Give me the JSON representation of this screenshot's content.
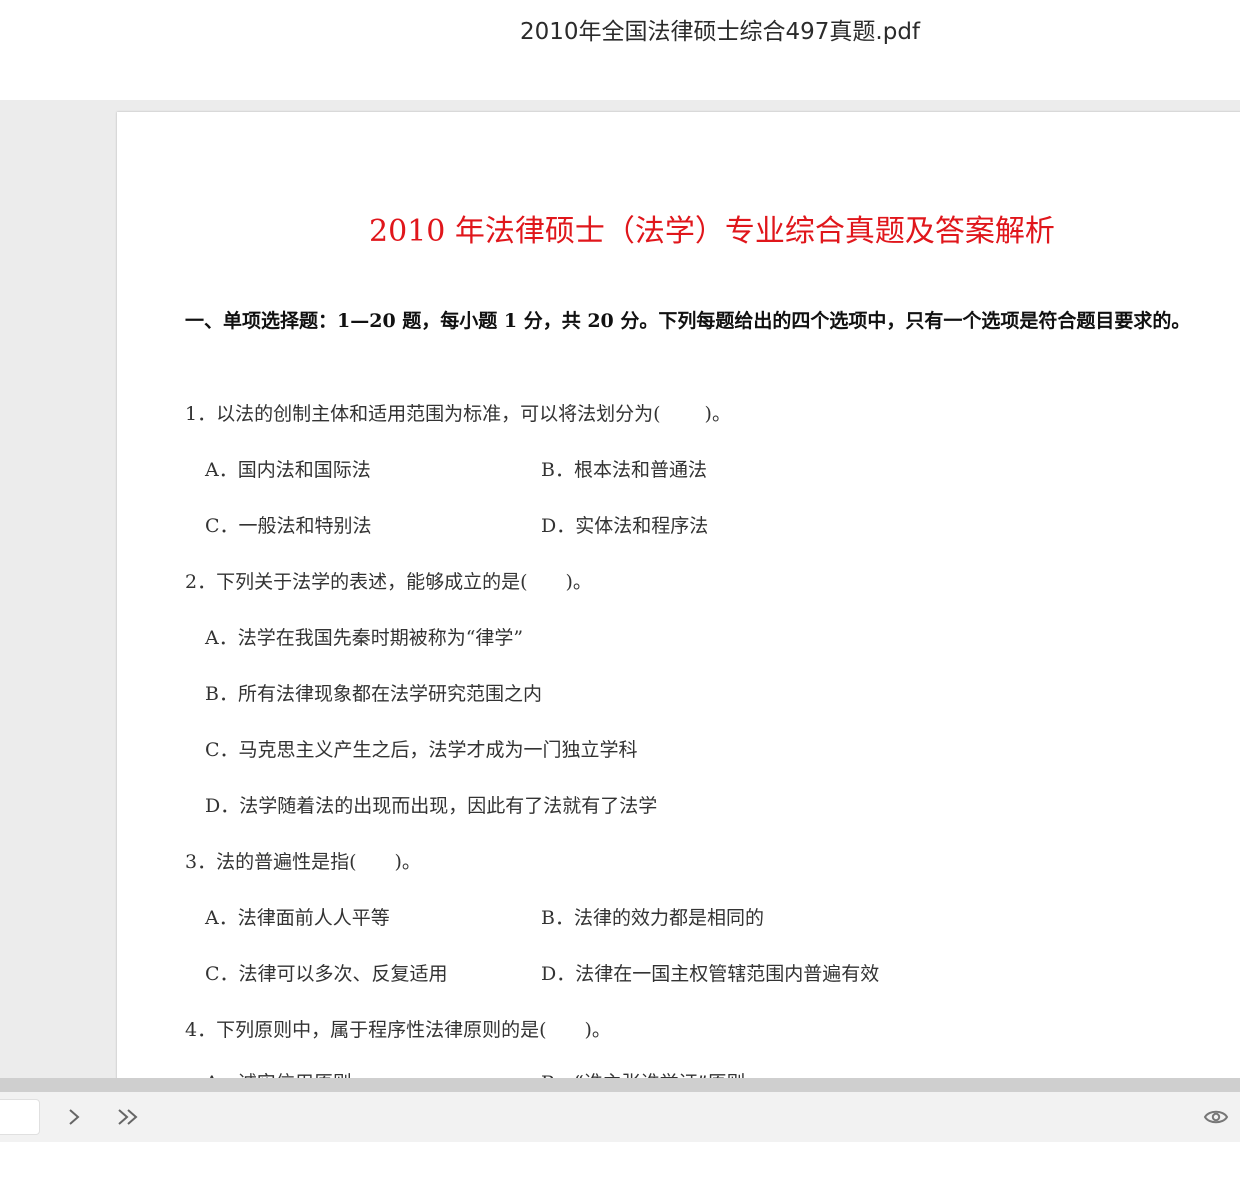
{
  "window": {
    "title": "2010年全国法律硕士综合497真题.pdf"
  },
  "document": {
    "heading": "2010 年法律硕士（法学）专业综合真题及答案解析",
    "section_intro": " 一、单项选择题：1—20 题，每小题 1 分，共 20 分。下列每题给出的四个选项中，只有一个选项是符合题目要求的。",
    "questions": [
      {
        "text": "1．以法的创制主体和适用范围为标准，可以将法划分为(　　 )。",
        "options": [
          "A．国内法和国际法",
          "B．根本法和普通法",
          "C．一般法和特别法",
          "D．实体法和程序法"
        ]
      },
      {
        "text": "2．下列关于法学的表述，能够成立的是(　　)。",
        "options": [
          "A．法学在我国先秦时期被称为“律学”",
          "B．所有法律现象都在法学研究范围之内",
          "C．马克思主义产生之后，法学才成为一门独立学科",
          "D．法学随着法的出现而出现，因此有了法就有了法学"
        ]
      },
      {
        "text": "3．法的普遍性是指(　　)。",
        "options": [
          "A．法律面前人人平等",
          "B．法律的效力都是相同的",
          "C．法律可以多次、反复适用",
          "D．法律在一国主权管辖范围内普遍有效"
        ]
      },
      {
        "text": "4．下列原则中，属于程序性法律原则的是(　　)。",
        "options": [
          "A．诚实信用原则",
          "B．“谁主张谁举证”原则"
        ]
      }
    ]
  },
  "toolbar": {
    "page_input_value": "",
    "next_icon": "chevron-right-icon",
    "last_icon": "double-chevron-right-icon",
    "view_icon": "eye-icon"
  },
  "colors": {
    "heading": "#e0161b",
    "viewer_bg": "#ececec",
    "toolbar_bg": "#f2f2f2"
  }
}
